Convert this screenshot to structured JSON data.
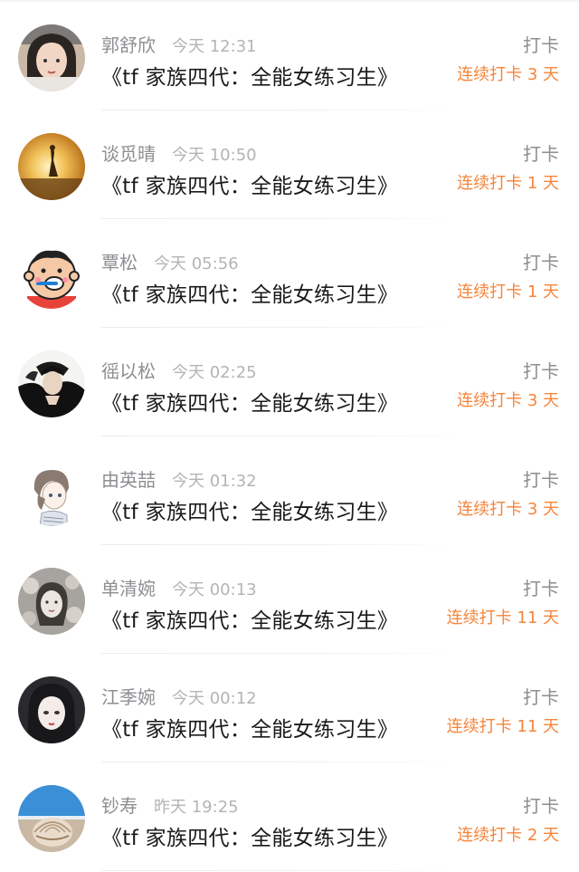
{
  "entries": [
    {
      "name": "郭舒欣",
      "time": "今天 12:31",
      "title": "《tf 家族四代：全能女练习生》",
      "action": "打卡",
      "streak": "连续打卡 3 天",
      "avatar": "avatar-girl-selfie"
    },
    {
      "name": "谈觅晴",
      "time": "今天 10:50",
      "title": "《tf 家族四代：全能女练习生》",
      "action": "打卡",
      "streak": "连续打卡 1 天",
      "avatar": "avatar-sunset-silhouette"
    },
    {
      "name": "覃松",
      "time": "今天 05:56",
      "title": "《tf 家族四代：全能女练习生》",
      "action": "打卡",
      "streak": "连续打卡 1 天",
      "avatar": "avatar-cartoon-toothbrush"
    },
    {
      "name": "徭以松",
      "time": "今天 02:25",
      "title": "《tf 家族四代：全能女练习生》",
      "action": "打卡",
      "streak": "连续打卡 3 天",
      "avatar": "avatar-anime-dark"
    },
    {
      "name": "由英喆",
      "time": "今天 01:32",
      "title": "《tf 家族四代：全能女练习生》",
      "action": "打卡",
      "streak": "连续打卡 3 天",
      "avatar": "avatar-anime-sketch"
    },
    {
      "name": "单清婉",
      "time": "今天 00:13",
      "title": "《tf 家族四代：全能女练习生》",
      "action": "打卡",
      "streak": "连续打卡 11 天",
      "avatar": "avatar-girl-flowers"
    },
    {
      "name": "江季婉",
      "time": "今天 00:12",
      "title": "《tf 家族四代：全能女练习生》",
      "action": "打卡",
      "streak": "连续打卡 11 天",
      "avatar": "avatar-anime-girl"
    },
    {
      "name": "钞寿",
      "time": "昨天 19:25",
      "title": "《tf 家族四代：全能女练习生》",
      "action": "打卡",
      "streak": "连续打卡 2 天",
      "avatar": "avatar-seashell"
    }
  ],
  "colors": {
    "streak": "#f5853a",
    "name": "#8e8e93",
    "time": "#b4b4b8",
    "title": "#1a1a1a"
  }
}
